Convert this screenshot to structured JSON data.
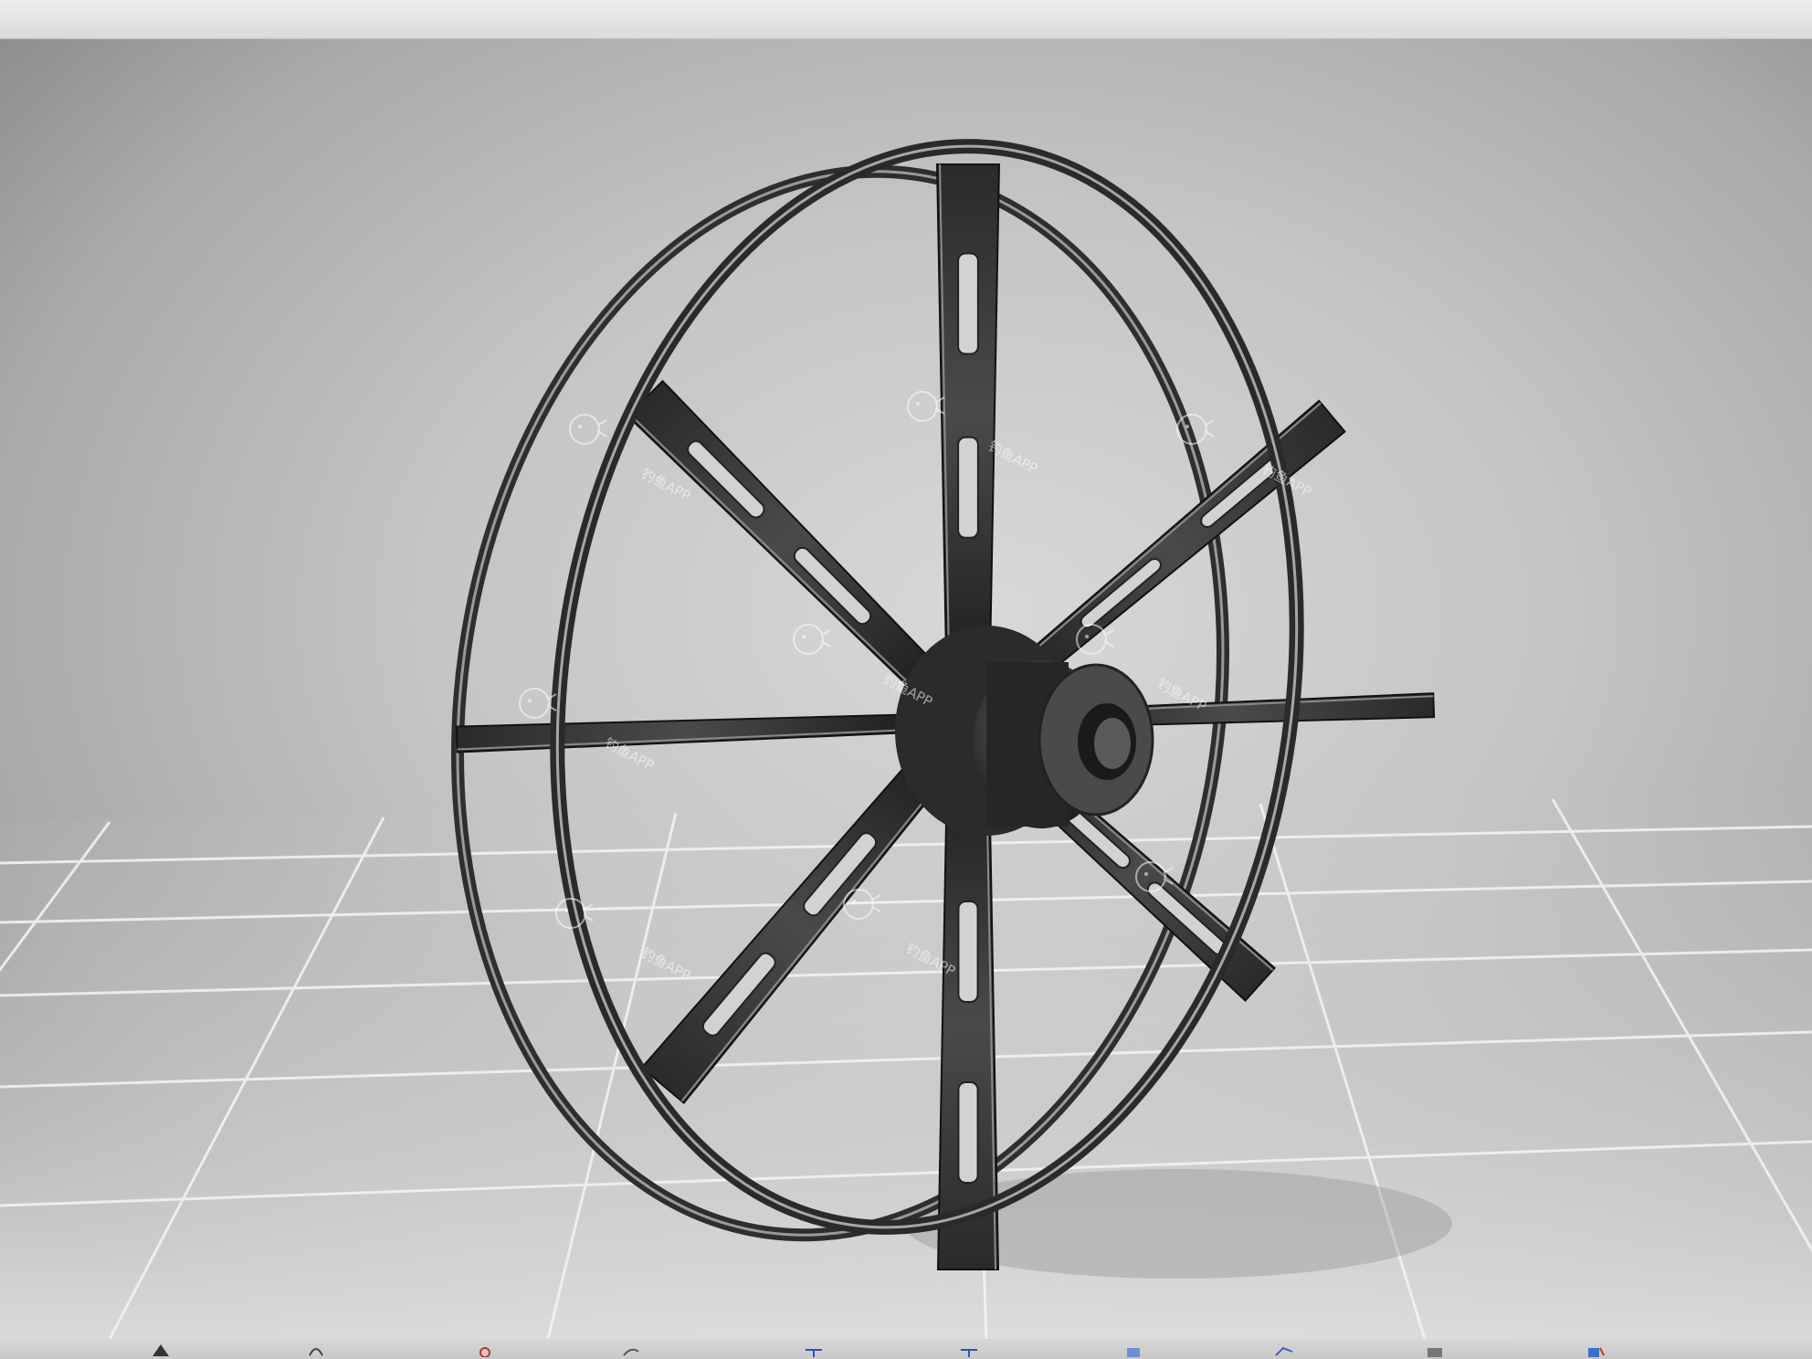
{
  "watermark": {
    "text": "钓鱼APP",
    "icon": "fish-face-icon"
  },
  "colors": {
    "background": "#c6c6c6",
    "model": "#3c3c3c",
    "grid": "#eeeeee",
    "top_strip": "#e4e4e4"
  },
  "toolbar": {
    "icons": [
      "triangle-icon",
      "rotate-icon",
      "sketch-icon",
      "curve-icon",
      "dimension-icon",
      "dimension-icon-2",
      "plane-icon",
      "grid-icon",
      "folder-icon",
      "save-icon"
    ]
  }
}
